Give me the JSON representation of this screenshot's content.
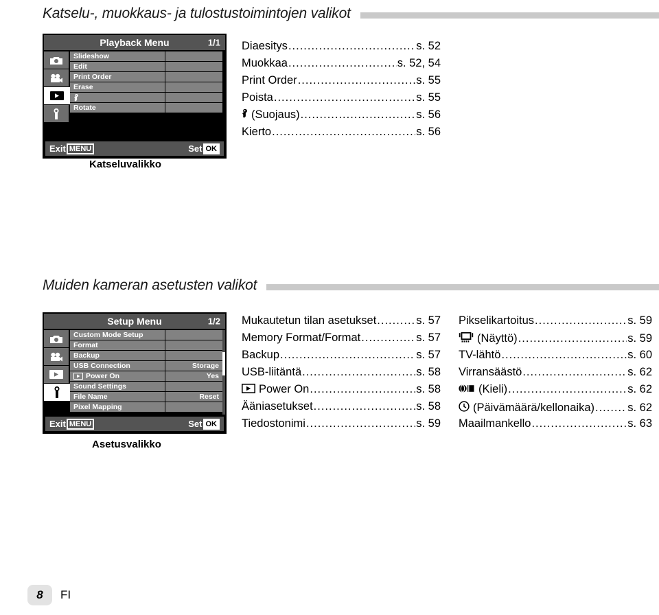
{
  "sections": [
    {
      "title": "Katselu-, muokkaus- ja tulostustoimintojen valikot"
    },
    {
      "title": "Muiden kameran asetusten valikot"
    }
  ],
  "playback_menu": {
    "title": "Playback Menu",
    "page": "1/1",
    "caption": "Katseluvalikko",
    "tabs": [
      {
        "icon": "camera-icon",
        "active": false
      },
      {
        "icon": "movie-camera-icon",
        "active": false
      },
      {
        "icon": "playback-icon",
        "active": true
      },
      {
        "icon": "wrench-icon",
        "active": false
      }
    ],
    "rows": [
      {
        "label": "Slideshow",
        "value": ""
      },
      {
        "label": "Edit",
        "value": ""
      },
      {
        "label": "Print Order",
        "value": ""
      },
      {
        "label": "Erase",
        "value": ""
      },
      {
        "label": "෴",
        "value": "",
        "icon": "protect-key-icon"
      },
      {
        "label": "Rotate",
        "value": ""
      }
    ],
    "exit_label": "Exit",
    "exit_key": "MENU",
    "set_label": "Set",
    "set_key": "OK"
  },
  "setup_menu": {
    "title": "Setup Menu",
    "page": "1/2",
    "caption": "Asetusvalikko",
    "tabs": [
      {
        "icon": "camera-icon",
        "active": false
      },
      {
        "icon": "movie-camera-icon",
        "active": false
      },
      {
        "icon": "playback-icon",
        "active": false
      },
      {
        "icon": "wrench-icon",
        "active": true
      }
    ],
    "rows": [
      {
        "label": "Custom Mode Setup",
        "value": ""
      },
      {
        "label": "Format",
        "value": ""
      },
      {
        "label": "Backup",
        "value": ""
      },
      {
        "label": "USB Connection",
        "value": "Storage"
      },
      {
        "label": "Power On",
        "value": "Yes",
        "icon": "playback-icon"
      },
      {
        "label": "Sound Settings",
        "value": ""
      },
      {
        "label": "File Name",
        "value": "Reset"
      },
      {
        "label": "Pixel Mapping",
        "value": ""
      }
    ],
    "exit_label": "Exit",
    "exit_key": "MENU",
    "set_label": "Set",
    "set_key": "OK"
  },
  "toc_playback": [
    {
      "label": "Diaesitys",
      "page": "s. 52"
    },
    {
      "label": "Muokkaa",
      "page": "s. 52, 54"
    },
    {
      "label": "Print Order",
      "page": "s. 55"
    },
    {
      "label": "Poista",
      "page": "s. 55"
    },
    {
      "label": "(Suojaus)",
      "page": "s. 56",
      "icon": "protect-key-icon"
    },
    {
      "label": "Kierto",
      "page": "s. 56"
    }
  ],
  "toc_setup_left": [
    {
      "label": "Mukautetun tilan asetukset",
      "page": "s. 57"
    },
    {
      "label": "Memory Format/Format",
      "page": "s. 57"
    },
    {
      "label": "Backup",
      "page": "s. 57"
    },
    {
      "label": "USB-liitäntä",
      "page": "s. 58"
    },
    {
      "label": "Power On",
      "page": "s. 58",
      "icon": "playback-icon"
    },
    {
      "label": "Ääniasetukset",
      "page": "s. 58"
    },
    {
      "label": "Tiedostonimi",
      "page": "s. 59"
    }
  ],
  "toc_setup_right": [
    {
      "label": "Pikselikartoitus",
      "page": "s. 59"
    },
    {
      "label": "(Näyttö)",
      "page": "s. 59",
      "icon": "monitor-brightness-icon"
    },
    {
      "label": "TV-lähtö",
      "page": "s. 60"
    },
    {
      "label": "Virransäästö",
      "page": "s. 62"
    },
    {
      "label": "(Kieli)",
      "page": "s. 62",
      "icon": "language-globe-icon"
    },
    {
      "label": "(Päivämäärä/kellonaika)",
      "page": "s. 62",
      "icon": "clock-icon"
    },
    {
      "label": "Maailmankello",
      "page": "s. 63"
    }
  ],
  "footer": {
    "page_number": "8",
    "language_code": "FI"
  },
  "colors": {
    "rule": "#c9c9c9",
    "lcd_header": "#545454",
    "lcd_row": "#828282",
    "lcd_tab": "#6e6e6e",
    "page_box": "#e3e3e3"
  }
}
